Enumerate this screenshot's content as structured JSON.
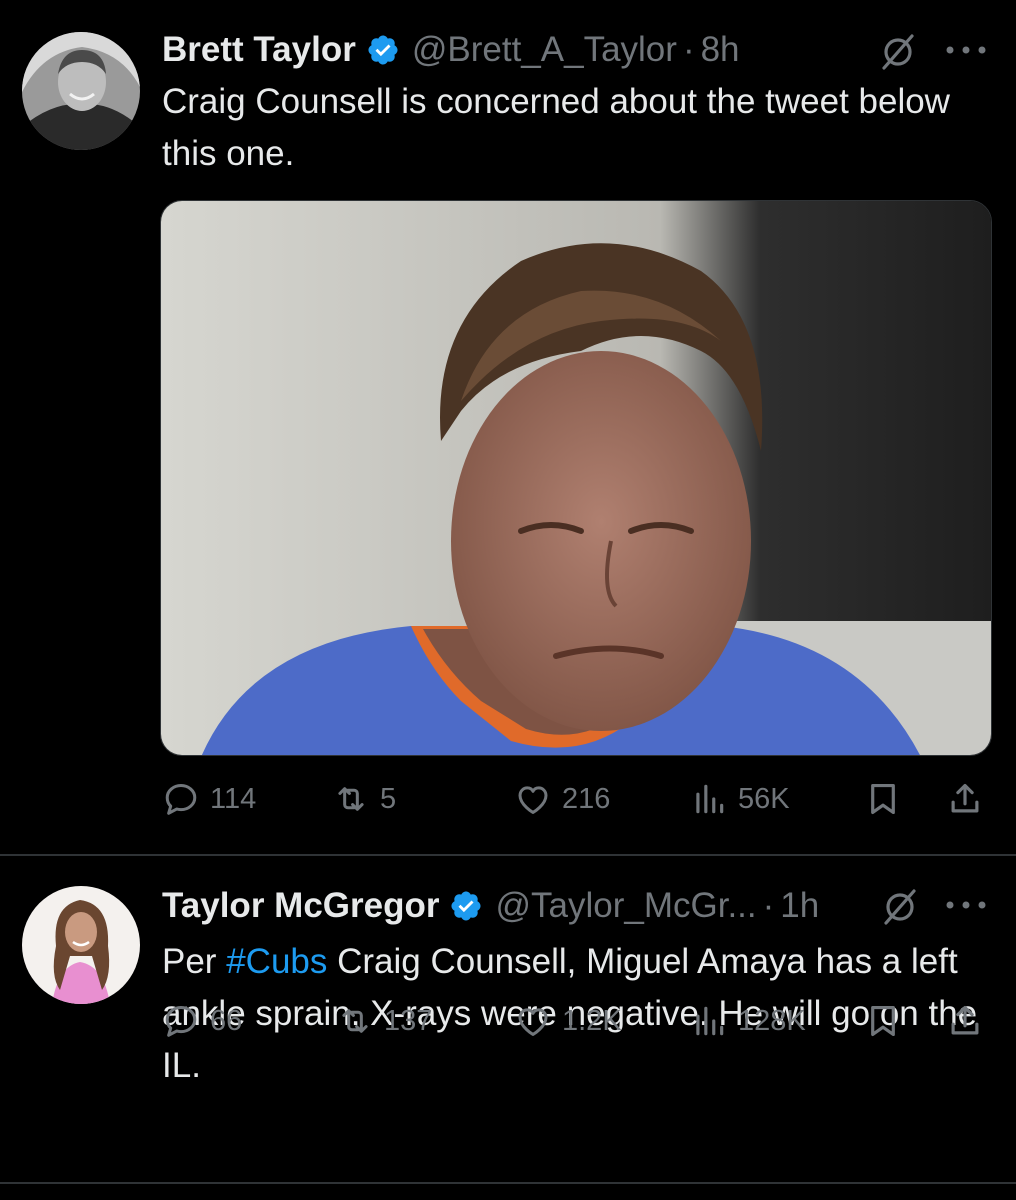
{
  "tweets": [
    {
      "author": {
        "name": "Brett Taylor",
        "handle": "@Brett_A_Taylor",
        "verified": true
      },
      "time": "8h",
      "text": "Craig Counsell is concerned about the tweet below this one.",
      "media": {
        "type": "photo",
        "alt": ""
      },
      "stats": {
        "replies": "114",
        "reposts": "5",
        "likes": "216",
        "views": "56K"
      }
    },
    {
      "author": {
        "name": "Taylor McGregor",
        "handle": "@Taylor_McGr...",
        "verified": true
      },
      "time": "1h",
      "text_before": "Per ",
      "hashtag": "#Cubs",
      "text_after": " Craig Counsell, Miguel Amaya has a left ankle sprain. X-rays were negative. He will go on the IL.",
      "stats": {
        "replies": "66",
        "reposts": "137",
        "likes": "1.2K",
        "views": "128K"
      }
    }
  ],
  "ui": {
    "separator": "·",
    "colors": {
      "background": "#000000",
      "text": "#e7e9ea",
      "muted": "#71767b",
      "accent": "#1d9bf0",
      "divider": "#2f3336"
    },
    "icons": [
      "verified-badge-icon",
      "grok-icon",
      "more-icon",
      "reply-icon",
      "repost-icon",
      "like-icon",
      "views-icon",
      "bookmark-icon",
      "share-icon"
    ]
  }
}
